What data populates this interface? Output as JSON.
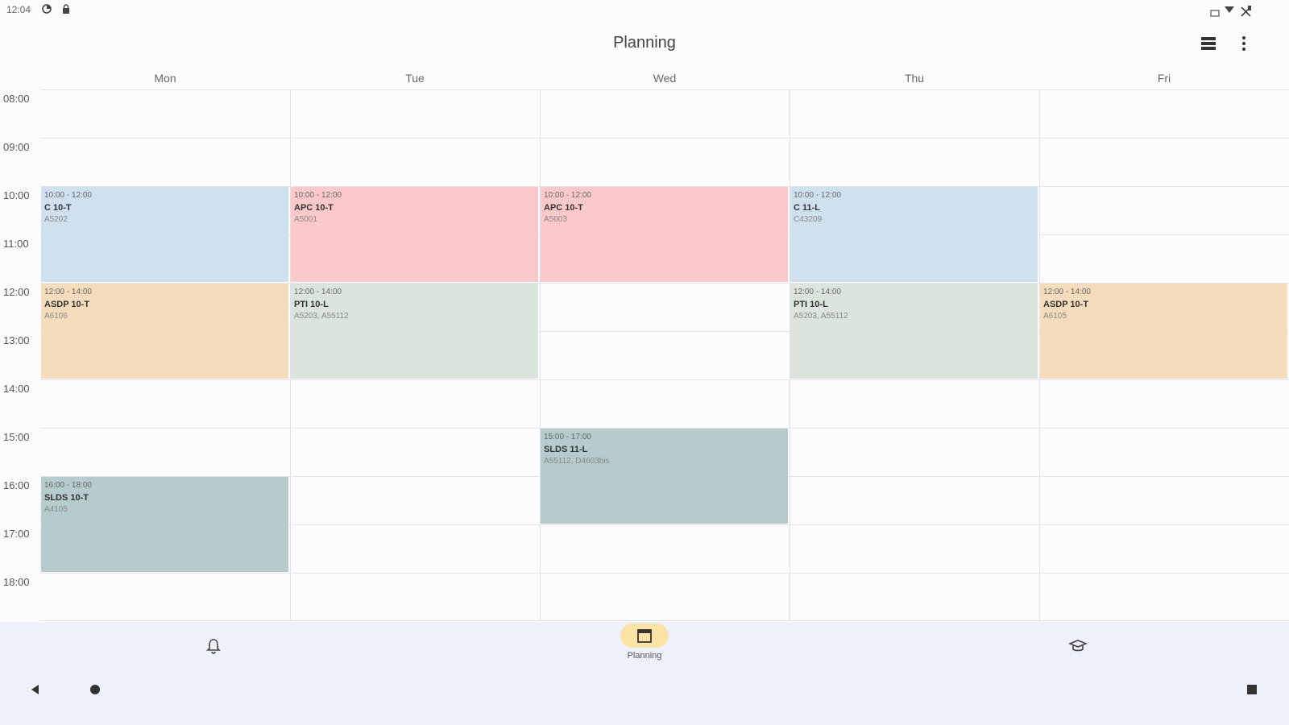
{
  "status_bar": {
    "time": "12:04"
  },
  "app_bar": {
    "title": "Planning"
  },
  "days": [
    "Mon",
    "Tue",
    "Wed",
    "Thu",
    "Fri"
  ],
  "hours": [
    "08:00",
    "09:00",
    "10:00",
    "11:00",
    "12:00",
    "13:00",
    "14:00",
    "15:00",
    "16:00",
    "17:00",
    "18:00"
  ],
  "events": [
    {
      "day": 0,
      "start": 10,
      "end": 12,
      "time": "10:00 - 12:00",
      "course": "C 10-T",
      "room": "A5202",
      "color": "#cfe0ee"
    },
    {
      "day": 1,
      "start": 10,
      "end": 12,
      "time": "10:00 - 12:00",
      "course": "APC 10-T",
      "room": "A5001",
      "color": "#fcc9cb"
    },
    {
      "day": 2,
      "start": 10,
      "end": 12,
      "time": "10:00 - 12:00",
      "course": "APC 10-T",
      "room": "A5003",
      "color": "#fcc9cb"
    },
    {
      "day": 3,
      "start": 10,
      "end": 12,
      "time": "10:00 - 12:00",
      "course": "C 11-L",
      "room": "C43209",
      "color": "#cfe0ee"
    },
    {
      "day": 0,
      "start": 12,
      "end": 14,
      "time": "12:00 - 14:00",
      "course": "ASDP 10-T",
      "room": "A6106",
      "color": "#f4dcbc"
    },
    {
      "day": 1,
      "start": 12,
      "end": 14,
      "time": "12:00 - 14:00",
      "course": "PTI 10-L",
      "room": "A5203, A55112",
      "color": "#dbe5dd"
    },
    {
      "day": 3,
      "start": 12,
      "end": 14,
      "time": "12:00 - 14:00",
      "course": "PTI 10-L",
      "room": "A5203, A55112",
      "color": "#dbe5dd"
    },
    {
      "day": 4,
      "start": 12,
      "end": 14,
      "time": "12:00 - 14:00",
      "course": "ASDP 10-T",
      "room": "A6105",
      "color": "#f4dcbc"
    },
    {
      "day": 2,
      "start": 15,
      "end": 17,
      "time": "15:00 - 17:00",
      "course": "SLDS 11-L",
      "room": "A55112, D4603bis",
      "color": "#b6cbcc"
    },
    {
      "day": 0,
      "start": 16,
      "end": 18,
      "time": "16:00 - 18:00",
      "course": "SLDS 10-T",
      "room": "A4105",
      "color": "#b6cbcc"
    }
  ],
  "bottom_nav": {
    "items": [
      {
        "icon": "bell-icon",
        "label": ""
      },
      {
        "icon": "calendar-icon",
        "label": "Planning"
      },
      {
        "icon": "graduation-cap-icon",
        "label": ""
      }
    ],
    "active_color": "#fbe3a5"
  }
}
